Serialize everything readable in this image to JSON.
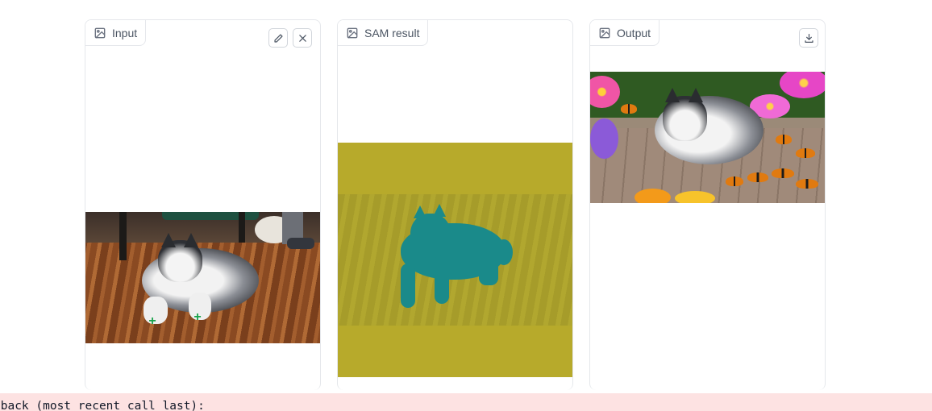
{
  "panels": {
    "input": {
      "label": "Input",
      "icon": "image-icon",
      "tools": [
        "pencil-icon",
        "close-icon"
      ]
    },
    "sam": {
      "label": "SAM result",
      "icon": "image-icon"
    },
    "output": {
      "label": "Output",
      "icon": "image-icon",
      "tools": [
        "download-icon"
      ]
    }
  },
  "input_points": [
    "+",
    "+"
  ],
  "colors": {
    "point_marker": "#16a34a",
    "sam_overlay": "#b7aa2b",
    "sam_mask": "#1a8a8a",
    "error_background": "#fde2e2"
  },
  "error": {
    "text": "eback (most recent call last):"
  }
}
